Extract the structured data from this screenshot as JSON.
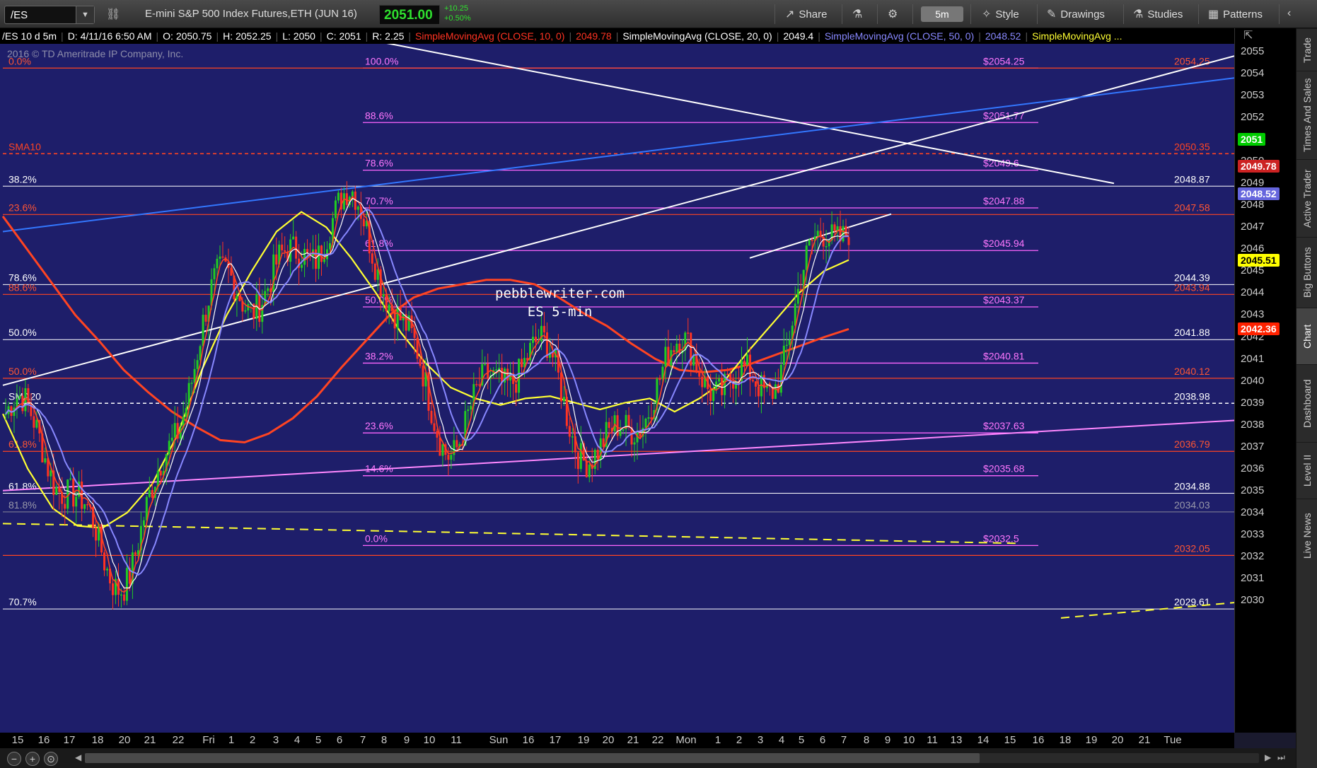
{
  "toolbar": {
    "symbol": "/ES",
    "instrument_name": "E-mini S&P 500 Index Futures,ETH (JUN 16)",
    "last_price": "2051.00",
    "change_abs": "+10.25",
    "change_pct": "+0.50%",
    "share": "Share",
    "interval": "5m",
    "style": "Style",
    "drawings": "Drawings",
    "studies": "Studies",
    "patterns": "Patterns"
  },
  "study_header": {
    "symbol_info": "/ES 10 d 5m",
    "date": "D: 4/11/16 6:50 AM",
    "open": "O: 2050.75",
    "high": "H: 2052.25",
    "low": "L: 2050",
    "close": "C: 2051",
    "range": "R: 2.25",
    "sma10_label": "SimpleMovingAvg (CLOSE, 10, 0)",
    "sma10_value": "2049.78",
    "sma20_label": "SimpleMovingAvg (CLOSE, 20, 0)",
    "sma20_value": "2049.4",
    "sma50_label": "SimpleMovingAvg (CLOSE, 50, 0)",
    "sma50_value": "2048.52",
    "sma_more_label": "SimpleMovingAvg ..."
  },
  "copyright": "2016 © TD Ameritrade IP Company, Inc.",
  "watermark": {
    "line1": "pebblewriter.com",
    "line2": "ES 5-min"
  },
  "colors": {
    "chart_bg": "#1e1e6a",
    "sma10": "#ff4422",
    "sma20": "#ffffff",
    "sma50": "#8888ff",
    "sma_yellow": "#ffff33",
    "fib_pink": "#ff66ff",
    "fib_red": "#ff4422",
    "up_candle": "#22cc22",
    "down_candle": "#ff3322"
  },
  "chart_data": {
    "type": "line",
    "title": "/ES 10 d 5m",
    "ylim": [
      2029.5,
      2055.5
    ],
    "price_ticks": [
      2055,
      2054,
      2053,
      2052,
      2051,
      2050,
      2049,
      2048,
      2047,
      2046,
      2045,
      2044,
      2043,
      2042,
      2041,
      2040,
      2039,
      2038,
      2037,
      2036,
      2035,
      2034,
      2033,
      2032,
      2031,
      2030
    ],
    "time_ticks": [
      "15",
      "16",
      "17",
      "18",
      "20",
      "21",
      "22",
      "Fri",
      "1",
      "2",
      "3",
      "4",
      "5",
      "6",
      "7",
      "8",
      "9",
      "10",
      "11",
      "Sun",
      "16",
      "17",
      "19",
      "20",
      "21",
      "22",
      "Mon",
      "1",
      "2",
      "3",
      "4",
      "5",
      "6",
      "7",
      "8",
      "9",
      "10",
      "11",
      "13",
      "14",
      "15",
      "16",
      "18",
      "19",
      "20",
      "21",
      "Tue"
    ],
    "price_badges": [
      {
        "label": "2051",
        "value": 2051,
        "bg": "#00cc00",
        "fg": "#ffffff"
      },
      {
        "label": "2049.78",
        "value": 2049.78,
        "bg": "#cc2222",
        "fg": "#ffffff"
      },
      {
        "label": "2048.52",
        "value": 2048.52,
        "bg": "#6666dd",
        "fg": "#ffffff"
      },
      {
        "label": "2045.51",
        "value": 2045.51,
        "bg": "#ffff00",
        "fg": "#000000"
      },
      {
        "label": "2042.36",
        "value": 2042.36,
        "bg": "#ff2200",
        "fg": "#ffffff"
      }
    ],
    "fib_pink": [
      {
        "pct": "100.0%",
        "value": 2054.25,
        "label": "$2054.25"
      },
      {
        "pct": "88.6%",
        "value": 2051.77,
        "label": "$2051.77"
      },
      {
        "pct": "78.6%",
        "value": 2049.6,
        "label": "$2049.6"
      },
      {
        "pct": "70.7%",
        "value": 2047.88,
        "label": "$2047.88"
      },
      {
        "pct": "61.8%",
        "value": 2045.94,
        "label": "$2045.94"
      },
      {
        "pct": "50.0%",
        "value": 2043.37,
        "label": "$2043.37"
      },
      {
        "pct": "38.2%",
        "value": 2040.81,
        "label": "$2040.81"
      },
      {
        "pct": "23.6%",
        "value": 2037.63,
        "label": "$2037.63"
      },
      {
        "pct": "14.6%",
        "value": 2035.68,
        "label": "$2035.68"
      },
      {
        "pct": "0.0%",
        "value": 2032.5,
        "label": "$2032.5"
      }
    ],
    "fib_white": [
      {
        "pct": "38.2%",
        "value": 2048.87,
        "label": "2048.87"
      },
      {
        "pct": "78.6%",
        "value": 2044.39,
        "label": "2044.39"
      },
      {
        "pct": "50.0%",
        "value": 2041.88,
        "label": "2041.88"
      },
      {
        "pct": "61.8%",
        "value": 2034.88,
        "label": "2034.88"
      },
      {
        "pct": "70.7%",
        "value": 2029.61,
        "label": "2029.61"
      }
    ],
    "fib_red": [
      {
        "pct": "0.0%",
        "value": 2054.25,
        "label": "2054.25"
      },
      {
        "pct": "23.6%",
        "value": 2047.58,
        "label": "2047.58"
      },
      {
        "pct": "88.6%",
        "value": 2043.94,
        "label": "2043.94"
      },
      {
        "pct": "50.0%",
        "value": 2040.12,
        "label": "2040.12"
      },
      {
        "pct": "61.8%",
        "value": 2036.79,
        "label": "2036.79"
      },
      {
        "pct": "",
        "value": 2032.05,
        "label": "2032.05"
      }
    ],
    "fib_gray": [
      {
        "pct": "81.8%",
        "value": 2034.03,
        "label": "2034.03"
      }
    ],
    "sma_lines": [
      {
        "name": "SMA10",
        "label": "SMA10",
        "value": 2050.35,
        "label_value": "2050.35",
        "color": "#ff4422"
      },
      {
        "name": "SMA20",
        "label": "SMA20",
        "value": 2038.98,
        "label_value": "2038.98",
        "color": "#ffffff"
      }
    ],
    "sma200_red": [
      2047.5,
      2046.0,
      2044.5,
      2043.0,
      2041.8,
      2040.5,
      2039.5,
      2038.6,
      2037.9,
      2037.3,
      2037.2,
      2037.6,
      2038.3,
      2039.3,
      2040.6,
      2041.8,
      2043.0,
      2043.8,
      2044.2,
      2044.4,
      2044.6,
      2044.6,
      2044.4,
      2043.8,
      2043.1,
      2042.5,
      2041.7,
      2041.0,
      2040.5,
      2040.4,
      2040.5,
      2040.8,
      2041.2,
      2041.6,
      2042.0,
      2042.36
    ],
    "sma_yellow_pts": [
      2038.5,
      2036.0,
      2034.2,
      2033.4,
      2033.3,
      2034.0,
      2035.3,
      2037.5,
      2040.5,
      2043.0,
      2045.0,
      2046.8,
      2047.7,
      2047.0,
      2045.6,
      2044.0,
      2042.2,
      2040.8,
      2039.7,
      2039.2,
      2038.9,
      2039.2,
      2039.3,
      2039.0,
      2038.7,
      2039.0,
      2039.2,
      2038.6,
      2039.2,
      2040.0,
      2041.4,
      2042.7,
      2044.0,
      2045.0,
      2045.51
    ],
    "drawn_lines": [
      {
        "name": "white-trend-up-long",
        "from": [
          "15",
          2039.8
        ],
        "to": [
          "Tue",
          2054.8
        ],
        "color": "#ffffff"
      },
      {
        "name": "white-trend-down",
        "from": [
          "5",
          2055.8
        ],
        "to": [
          "18",
          2049.0
        ],
        "color": "#ffffff"
      },
      {
        "name": "blue-trend",
        "from": [
          "15",
          2046.8
        ],
        "to": [
          "Tue",
          2053.8
        ],
        "color": "#3377ff"
      },
      {
        "name": "pink-trend",
        "from": [
          "15",
          2035.0
        ],
        "to": [
          "Tue",
          2038.2
        ],
        "color": "#ff88ff"
      },
      {
        "name": "yellow-dashed-trend",
        "from": [
          "15",
          2033.5
        ],
        "to": [
          "15",
          2032.6
        ],
        "color": "#ffff33"
      },
      {
        "name": "white-channel-low",
        "from": [
          "1",
          2045.6
        ],
        "to": [
          "8",
          2047.6
        ],
        "color": "#ffffff"
      }
    ]
  },
  "right_sidebar": [
    "Trade",
    "Times And Sales",
    "Active Trader",
    "Big Buttons",
    "Chart",
    "Dashboard",
    "Level II",
    "Live News"
  ]
}
